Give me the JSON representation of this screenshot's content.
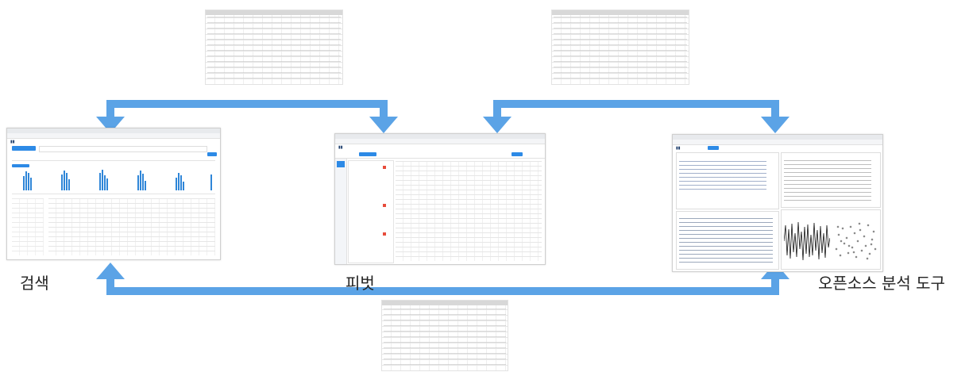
{
  "labels": {
    "search": "검색",
    "pivot": "피벗",
    "open_source": "오픈소스 분석 도구"
  },
  "colors": {
    "arrow": "#5ba3e6",
    "accent": "#2d8ae6"
  }
}
